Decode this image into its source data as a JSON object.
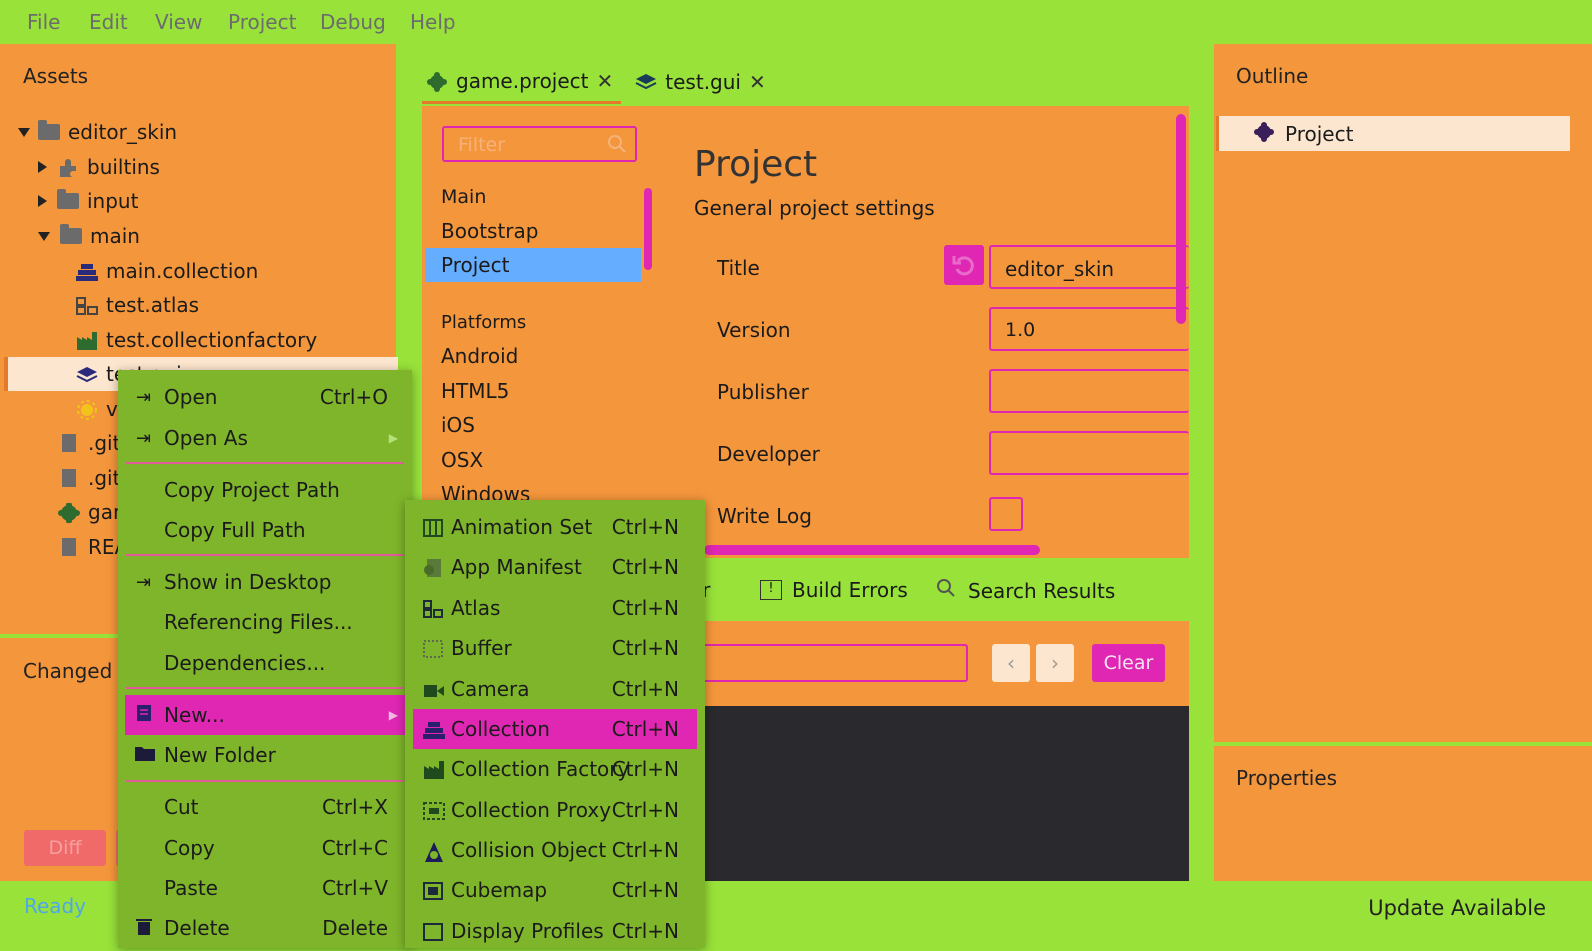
{
  "menubar": [
    "File",
    "Edit",
    "View",
    "Project",
    "Debug",
    "Help"
  ],
  "assets": {
    "title": "Assets",
    "tree": [
      {
        "label": "editor_skin",
        "icon": "folder-icon",
        "expand": "down"
      },
      {
        "label": "builtins",
        "icon": "puzzle-icon",
        "expand": "right"
      },
      {
        "label": "input",
        "icon": "folder-icon",
        "expand": "right"
      },
      {
        "label": "main",
        "icon": "folder-icon",
        "expand": "down"
      },
      {
        "label": "main.collection",
        "icon": "collection-icon"
      },
      {
        "label": "test.atlas",
        "icon": "atlas-icon"
      },
      {
        "label": "test.collectionfactory",
        "icon": "factory-icon"
      },
      {
        "label": "test.gui",
        "icon": "gui-icon"
      },
      {
        "label": "v...",
        "icon": "sun-icon"
      },
      {
        "label": ".gita...",
        "icon": "file-icon"
      },
      {
        "label": ".giti...",
        "icon": "file-icon"
      },
      {
        "label": "gam...",
        "icon": "gear-icon"
      },
      {
        "label": "REA...",
        "icon": "file-icon"
      }
    ]
  },
  "changed_files": {
    "title": "Changed Fi",
    "diff": "Diff"
  },
  "status": {
    "left": "Ready",
    "right": "Update Available"
  },
  "tabs": [
    {
      "label": "game.project",
      "icon": "gear-icon"
    },
    {
      "label": "test.gui",
      "icon": "gui-icon"
    }
  ],
  "settings": {
    "filter_placeholder": "Filter",
    "nav": [
      "Main",
      "Bootstrap",
      "Project"
    ],
    "platforms_heading": "Platforms",
    "platforms": [
      "Android",
      "HTML5",
      "iOS",
      "OSX",
      "Windows"
    ],
    "heading": "Project",
    "subheading": "General project settings",
    "fields": [
      {
        "label": "Title",
        "value": "editor_skin"
      },
      {
        "label": "Version",
        "value": "1.0"
      },
      {
        "label": "Publisher",
        "value": ""
      },
      {
        "label": "Developer",
        "value": ""
      },
      {
        "label": "Write Log",
        "value": ""
      }
    ]
  },
  "bottom_tabs": [
    "or",
    "Build Errors",
    "Search Results"
  ],
  "console": {
    "clear": "Clear"
  },
  "outline": {
    "title": "Outline",
    "item": "Project"
  },
  "properties": {
    "title": "Properties"
  },
  "context_menu": [
    {
      "label": "Open",
      "shortcut": "Ctrl+O",
      "icon": "open-icon"
    },
    {
      "label": "Open As",
      "shortcut": "",
      "icon": "open-icon",
      "submenu": true
    },
    {
      "label": "Copy Project Path",
      "shortcut": ""
    },
    {
      "label": "Copy Full Path",
      "shortcut": ""
    },
    {
      "label": "Show in Desktop",
      "shortcut": "",
      "icon": "open-icon"
    },
    {
      "label": "Referencing Files...",
      "shortcut": ""
    },
    {
      "label": "Dependencies...",
      "shortcut": ""
    },
    {
      "label": "New...",
      "shortcut": "",
      "icon": "new-file-icon",
      "submenu": true
    },
    {
      "label": "New Folder",
      "shortcut": "",
      "icon": "folder-icon"
    },
    {
      "label": "Cut",
      "shortcut": "Ctrl+X"
    },
    {
      "label": "Copy",
      "shortcut": "Ctrl+C"
    },
    {
      "label": "Paste",
      "shortcut": "Ctrl+V"
    },
    {
      "label": "Delete",
      "shortcut": "Delete",
      "icon": "trash-icon"
    }
  ],
  "new_submenu": [
    {
      "label": "Animation Set",
      "shortcut": "Ctrl+N",
      "icon": "animation-set-icon"
    },
    {
      "label": "App Manifest",
      "shortcut": "Ctrl+N",
      "icon": "manifest-icon"
    },
    {
      "label": "Atlas",
      "shortcut": "Ctrl+N",
      "icon": "atlas-icon"
    },
    {
      "label": "Buffer",
      "shortcut": "Ctrl+N",
      "icon": "buffer-icon"
    },
    {
      "label": "Camera",
      "shortcut": "Ctrl+N",
      "icon": "camera-icon"
    },
    {
      "label": "Collection",
      "shortcut": "Ctrl+N",
      "icon": "collection-icon"
    },
    {
      "label": "Collection Factory",
      "shortcut": "Ctrl+N",
      "icon": "factory-icon"
    },
    {
      "label": "Collection Proxy",
      "shortcut": "Ctrl+N",
      "icon": "proxy-icon"
    },
    {
      "label": "Collision Object",
      "shortcut": "Ctrl+N",
      "icon": "collision-icon"
    },
    {
      "label": "Cubemap",
      "shortcut": "Ctrl+N",
      "icon": "cubemap-icon"
    },
    {
      "label": "Display Profiles",
      "shortcut": "Ctrl+N",
      "icon": "display-icon"
    }
  ],
  "colors": {
    "accent": "#e027b4",
    "panel": "#f4963c",
    "chrome": "#98e23a",
    "menu": "#7fb52a",
    "selected": "#64adff"
  }
}
